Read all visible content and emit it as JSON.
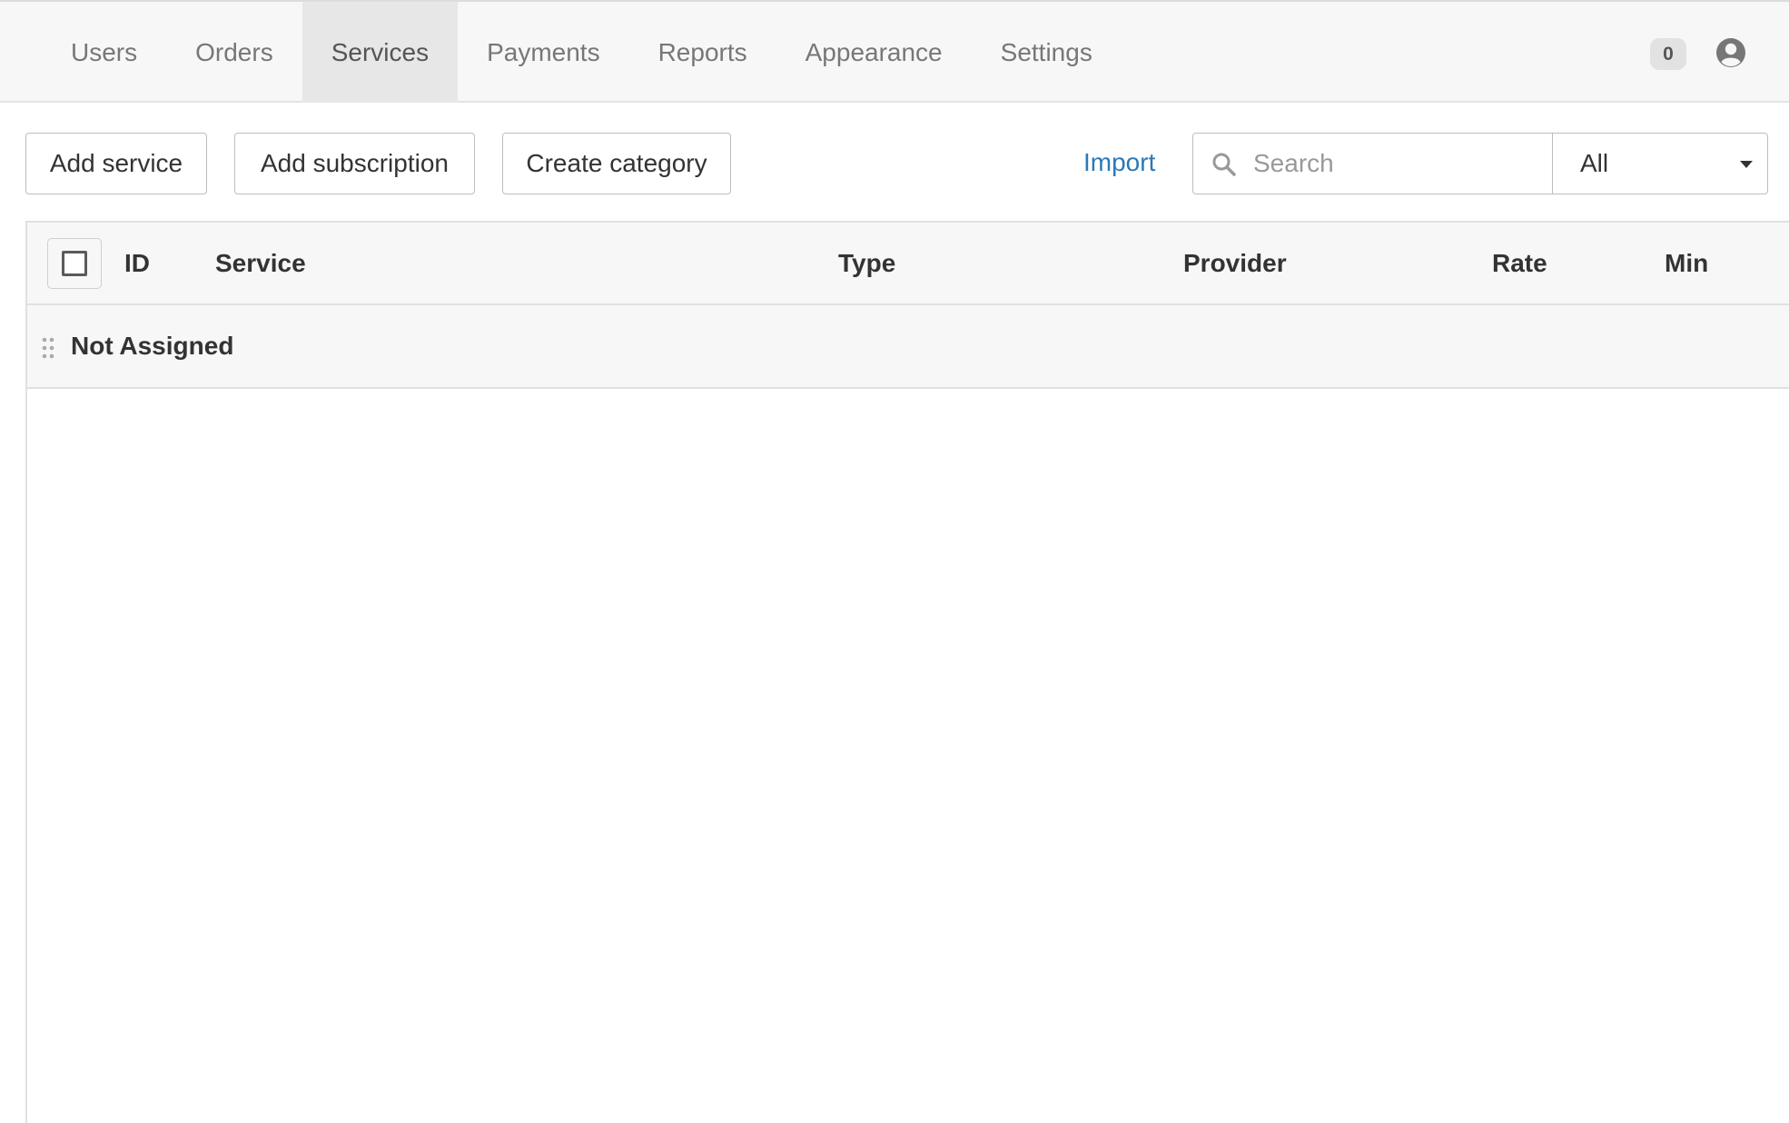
{
  "nav": {
    "items": [
      {
        "label": "Users",
        "active": false
      },
      {
        "label": "Orders",
        "active": false
      },
      {
        "label": "Services",
        "active": true
      },
      {
        "label": "Payments",
        "active": false
      },
      {
        "label": "Reports",
        "active": false
      },
      {
        "label": "Appearance",
        "active": false
      },
      {
        "label": "Settings",
        "active": false
      }
    ],
    "notification_count": "0",
    "user_icon": "user-circle-icon"
  },
  "toolbar": {
    "add_service_label": "Add service",
    "add_subscription_label": "Add subscription",
    "create_category_label": "Create category",
    "import_label": "Import",
    "search": {
      "placeholder": "Search",
      "value": "",
      "icon": "search-icon"
    },
    "filter": {
      "selected": "All",
      "icon": "caret-down-icon"
    }
  },
  "table": {
    "columns": [
      "ID",
      "Service",
      "Type",
      "Provider",
      "Rate",
      "Min"
    ],
    "categories": [
      {
        "name": "Not Assigned",
        "rows": []
      }
    ]
  },
  "colors": {
    "link": "#2a79b8",
    "nav_background": "#f7f7f7",
    "nav_active_background": "#e7e7e7",
    "border": "#e0e0e0"
  }
}
